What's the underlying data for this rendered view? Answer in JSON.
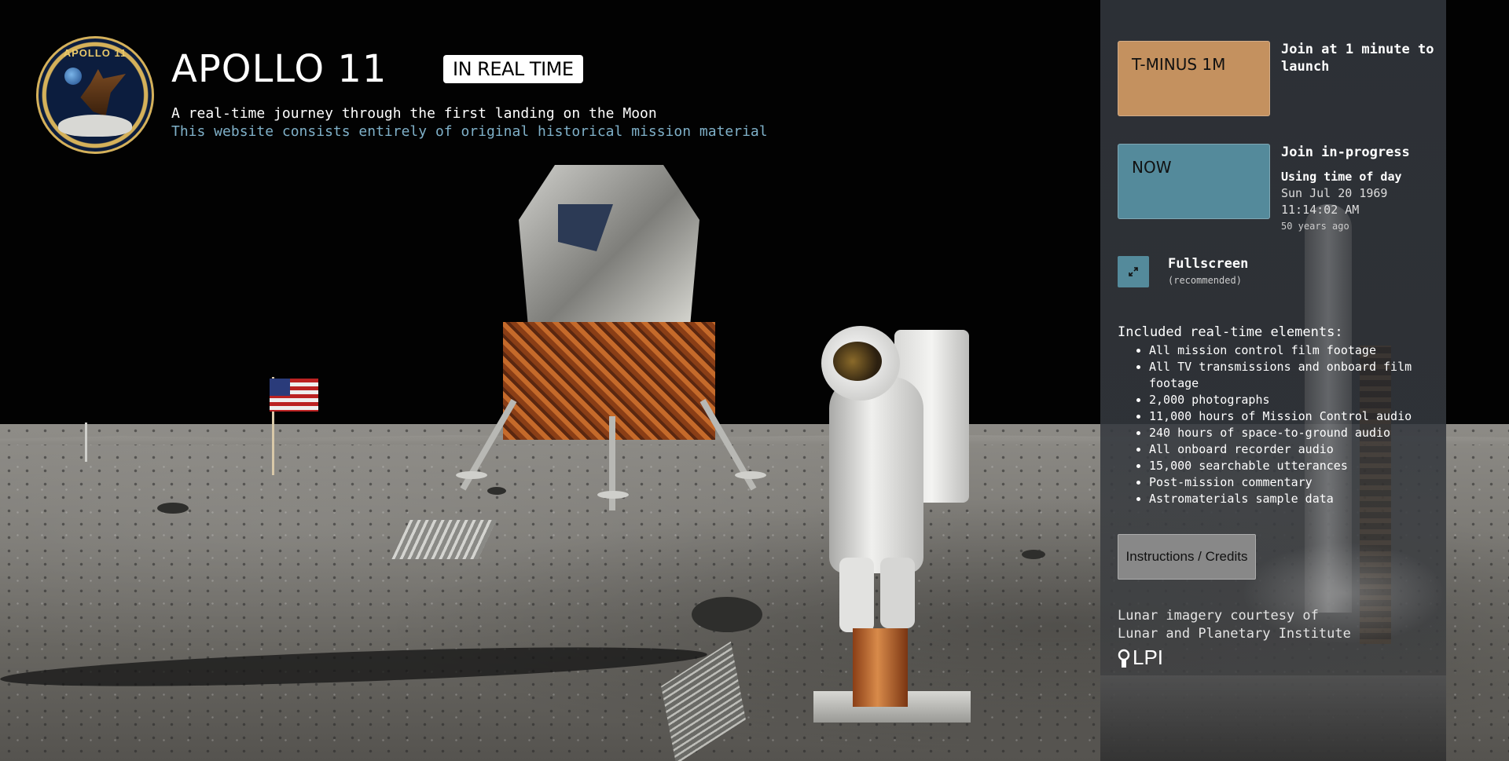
{
  "header": {
    "patch_text": "APOLLO 11",
    "title": "APOLLO 11",
    "badge": "IN REAL TIME",
    "subtitle": "A real-time journey through the first landing on the Moon",
    "subtitle2": "This website consists entirely of original historical mission material"
  },
  "panel": {
    "tminus": {
      "button_label": "T-MINUS 1M",
      "description": "Join at 1 minute to launch"
    },
    "now": {
      "button_label": "NOW",
      "description": "Join in-progress",
      "time_label": "Using time of day",
      "date": "Sun Jul 20 1969",
      "time": "11:14:02 AM",
      "ago": "50 years ago"
    },
    "fullscreen": {
      "label": "Fullscreen",
      "sub": "(recommended)"
    },
    "included": {
      "title": "Included real-time elements:",
      "items": [
        "All mission control film footage",
        "All TV transmissions and onboard film footage",
        "2,000 photographs",
        "11,000 hours of Mission Control audio",
        "240 hours of space-to-ground audio",
        "All onboard recorder audio",
        "15,000 searchable utterances",
        "Post-mission commentary",
        "Astromaterials sample data"
      ]
    },
    "instructions_label": "Instructions / Credits",
    "credit": {
      "line1": "Lunar imagery courtesy of",
      "line2": "Lunar and Planetary Institute",
      "logo_text": "LPI"
    }
  },
  "colors": {
    "tminus": "#c4915f",
    "now": "#548a9b",
    "subtitle2": "#7fb0c8"
  },
  "icons": {
    "fullscreen": "expand-arrows-icon",
    "lpi": "lpi-logo"
  }
}
